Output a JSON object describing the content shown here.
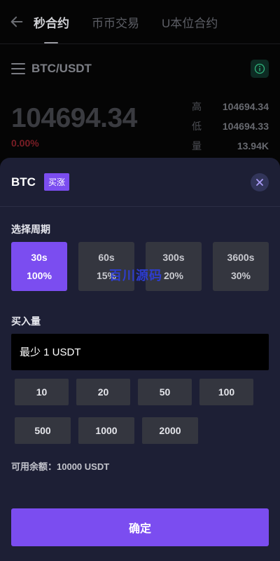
{
  "nav": {
    "tabs": [
      {
        "label": "秒合约"
      },
      {
        "label": "币币交易"
      },
      {
        "label": "U本位合约"
      }
    ]
  },
  "pair": {
    "name": "BTC/USDT"
  },
  "ticker": {
    "price": "104694.34",
    "change": "0.00%",
    "stats": [
      {
        "key": "高",
        "value": "104694.34"
      },
      {
        "key": "低",
        "value": "104694.33"
      },
      {
        "key": "量",
        "value": "13.94K"
      }
    ]
  },
  "sheet": {
    "coin": "BTC",
    "side_badge": "买涨",
    "period_label": "选择周期",
    "periods": [
      {
        "time": "30s",
        "rate": "100%"
      },
      {
        "time": "60s",
        "rate": "15%"
      },
      {
        "time": "300s",
        "rate": "20%"
      },
      {
        "time": "3600s",
        "rate": "30%"
      }
    ],
    "selected_period": "30s",
    "amount_label": "买入量",
    "amount_placeholder": "最少 1 USDT",
    "chips_row1": [
      "10",
      "20",
      "50",
      "100"
    ],
    "chips_row2": [
      "500",
      "1000",
      "2000"
    ],
    "balance_text": "可用余额：10000 USDT",
    "confirm_label": "确定",
    "watermark": "百川源码"
  },
  "colors": {
    "accent": "#7b4df0",
    "sheet_bg": "#1d1f35",
    "chip_bg": "#34363f",
    "info_green": "#2fb37b"
  }
}
